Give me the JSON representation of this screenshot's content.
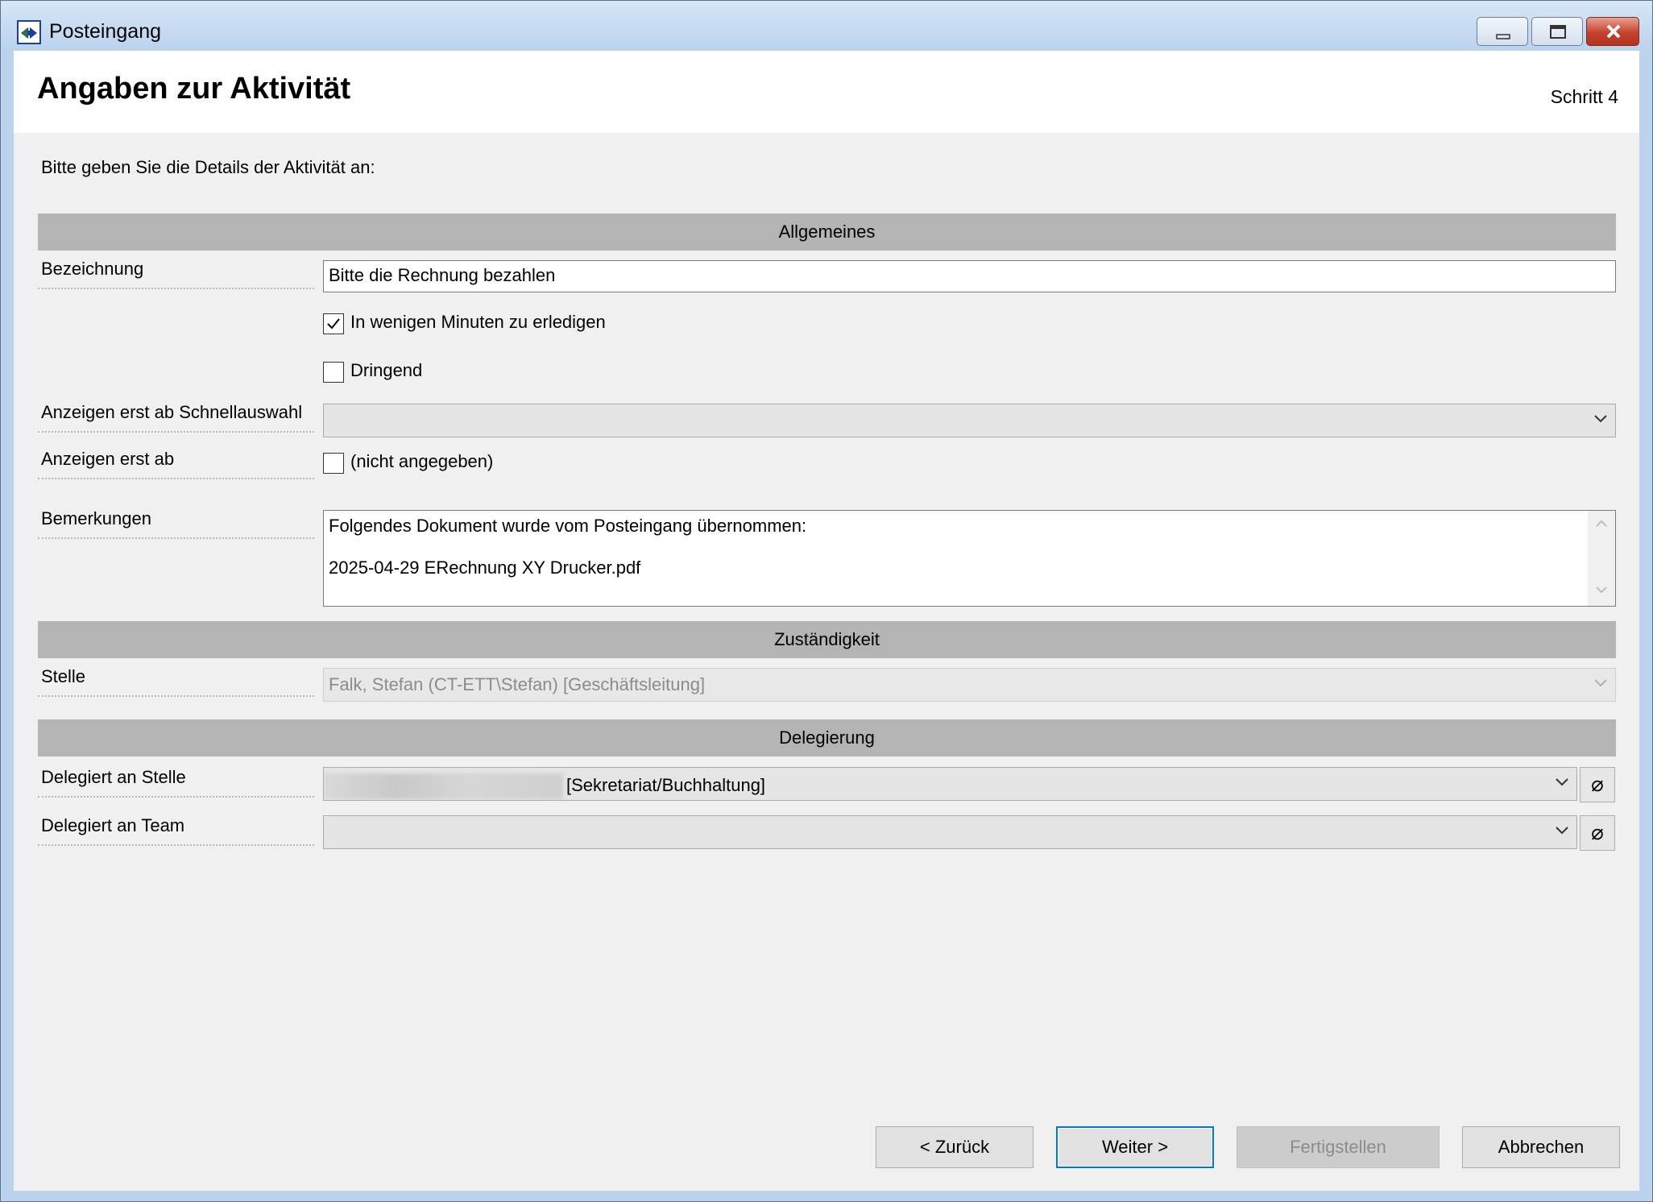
{
  "window": {
    "title": "Posteingang"
  },
  "header": {
    "title": "Angaben zur Aktivität",
    "step": "Schritt 4"
  },
  "intro": "Bitte geben Sie die Details der Aktivität an:",
  "sections": {
    "general": "Allgemeines",
    "responsibility": "Zuständigkeit",
    "delegation": "Delegierung"
  },
  "fields": {
    "bezeichnung": {
      "label": "Bezeichnung",
      "value": "Bitte die Rechnung bezahlen"
    },
    "quick_task": {
      "label": "In wenigen Minuten zu erledigen",
      "checked": true
    },
    "urgent": {
      "label": "Dringend",
      "checked": false
    },
    "show_from_quick": {
      "label": "Anzeigen erst ab Schnellauswahl",
      "value": ""
    },
    "show_from": {
      "label": "Anzeigen erst ab",
      "checkbox_label": "(nicht angegeben)",
      "checked": false
    },
    "remarks": {
      "label": "Bemerkungen",
      "line1": "Folgendes Dokument wurde vom Posteingang übernommen:",
      "line2": "2025-04-29 ERechnung XY Drucker.pdf"
    },
    "stelle": {
      "label": "Stelle",
      "value": "Falk, Stefan (CT-ETT\\Stefan) [Geschäftsleitung]"
    },
    "delegated_position": {
      "label": "Delegiert an Stelle",
      "value_visible": "[Sekretariat/Buchhaltung]"
    },
    "delegated_team": {
      "label": "Delegiert an Team",
      "value": ""
    }
  },
  "icons": {
    "clear": "⌀",
    "app": "double-arrow-icon",
    "dropdown": "chevron-down-icon"
  },
  "buttons": {
    "back": "< Zurück",
    "next": "Weiter >",
    "finish": "Fertigstellen",
    "cancel": "Abbrechen"
  },
  "colors": {
    "section_header": "#b4b4b4",
    "default_button_border": "#0078d7",
    "title_bar": "#bcd3ee"
  }
}
